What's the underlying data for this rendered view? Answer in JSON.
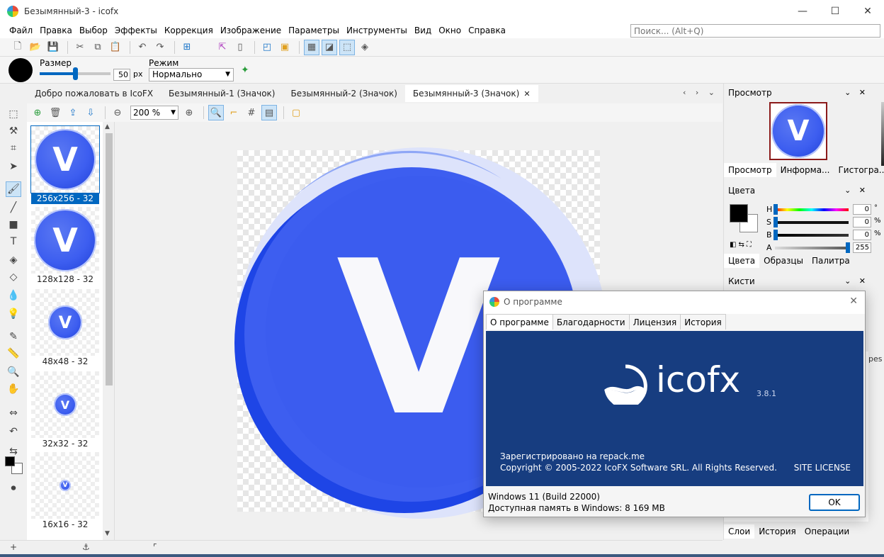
{
  "window": {
    "title": "Безымянный-3 - icofx",
    "min": "—",
    "max": "☐",
    "close": "✕"
  },
  "menu": [
    "Файл",
    "Правка",
    "Выбор",
    "Эффекты",
    "Коррекция",
    "Изображение",
    "Параметры",
    "Инструменты",
    "Вид",
    "Окно",
    "Справка"
  ],
  "search": {
    "placeholder": "Поиск... (Alt+Q)"
  },
  "options": {
    "size_label": "Размер",
    "size_value": "50",
    "size_unit": "px",
    "mode_label": "Режим",
    "mode_value": "Нормально",
    "size_fraction": 0.5
  },
  "doc_tabs": [
    {
      "label": "Добро пожаловать в IcoFX"
    },
    {
      "label": "Безымянный-1 (Значок)"
    },
    {
      "label": "Безымянный-2 (Значок)"
    },
    {
      "label": "Безымянный-3 (Значок)",
      "close": "✕"
    }
  ],
  "doc_tab_nav": "‹ › ⌄",
  "zoom": "200 %",
  "images": [
    {
      "caption": "256x256 - 32",
      "letter": "V"
    },
    {
      "caption": "128x128 - 32",
      "letter": "V"
    },
    {
      "caption": "48x48 - 32",
      "letter": "V"
    },
    {
      "caption": "32x32 - 32",
      "letter": "V"
    },
    {
      "caption": "16x16 - 32",
      "letter": "V"
    }
  ],
  "canvas_letter": "V",
  "right": {
    "preview": {
      "title": "Просмотр",
      "tabs": [
        "Просмотр",
        "Информа...",
        "Гистогра..."
      ],
      "letter": "V"
    },
    "colors": {
      "title": "Цвета",
      "rows": [
        {
          "label": "H",
          "value": "0",
          "unit": "°"
        },
        {
          "label": "S",
          "value": "0",
          "unit": "%"
        },
        {
          "label": "B",
          "value": "0",
          "unit": "%"
        },
        {
          "label": "A",
          "value": "255",
          "unit": ""
        }
      ],
      "tabs": [
        "Цвета",
        "Образцы",
        "Палитра"
      ]
    },
    "brushes": {
      "title": "Кисти"
    },
    "bottom_tabs": [
      "Слои",
      "История",
      "Операции"
    ],
    "partial": "pes",
    "panel_ctl": "⌄ ✕"
  },
  "about": {
    "title": "О программе",
    "close": "✕",
    "tabs": [
      "О программе",
      "Благодарности",
      "Лицензия",
      "История"
    ],
    "logo": "icofx",
    "version": "3.8.1",
    "registered": "Зарегистрировано на repack.me",
    "copyright": "Copyright © 2005-2022 IcoFX Software SRL. All Rights Reserved.",
    "license": "SITE LICENSE",
    "os": "Windows 11 (Build 22000)",
    "memory": "Доступная память в Windows:  8 169 MB",
    "ok": "OK"
  },
  "status": {
    "plus": "+",
    "anchor": "⚓",
    "corner": "⌜"
  }
}
